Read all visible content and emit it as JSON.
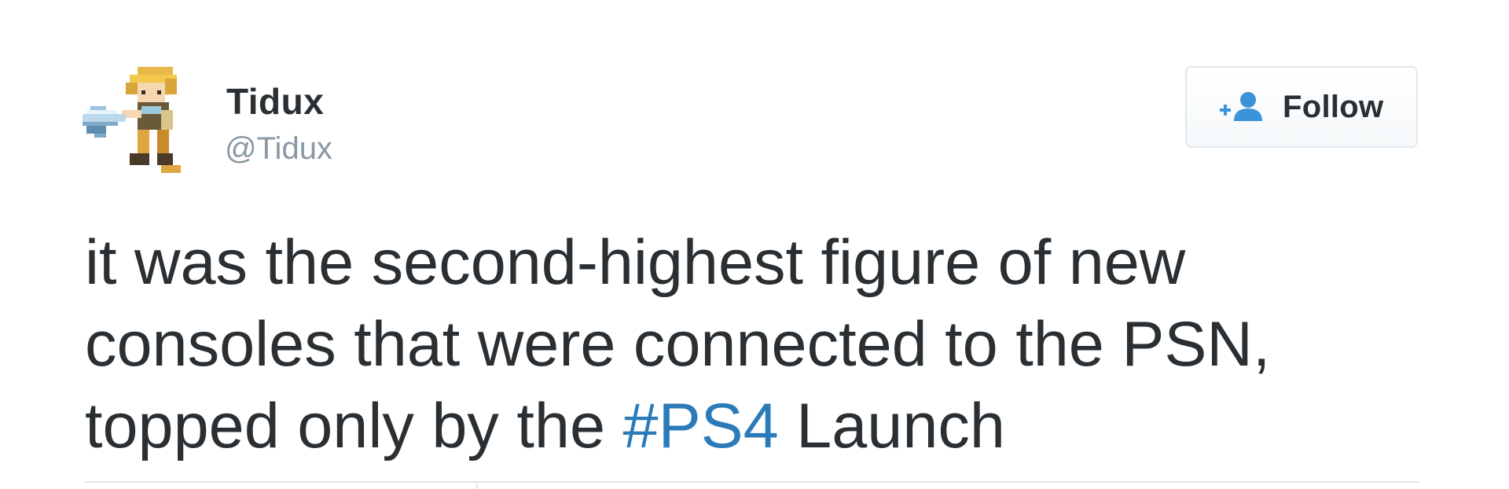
{
  "user": {
    "name": "Tidux",
    "handle": "@Tidux",
    "avatar_icon": "pixel-art-swordsman-avatar"
  },
  "follow_button": {
    "label": "Follow",
    "icon": "add-user-icon"
  },
  "tweet": {
    "text_before_hashtag": "it was the second-highest figure of new consoles that were connected to the PSN, topped only by the ",
    "hashtag": "#PS4",
    "text_after_hashtag": " Launch"
  },
  "colors": {
    "text": "#292f33",
    "handle": "#8899a6",
    "link": "#2b7bb9",
    "border": "#e1e8ed"
  }
}
